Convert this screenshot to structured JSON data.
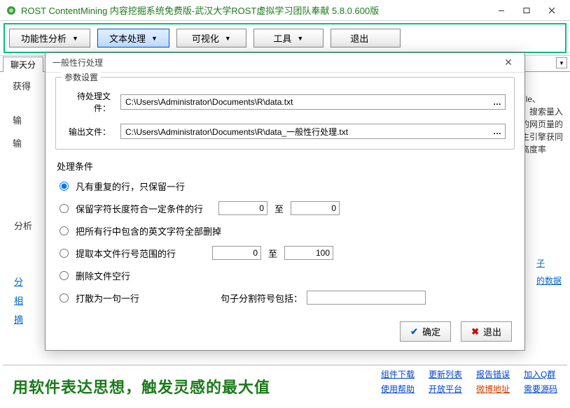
{
  "titlebar": {
    "text": "ROST ContentMining 内容挖掘系统免费版-武汉大学ROST虚拟学习团队奉献  5.8.0.600版"
  },
  "toolbar": {
    "items": [
      {
        "label": "功能性分析"
      },
      {
        "label": "文本处理"
      },
      {
        "label": "可视化"
      },
      {
        "label": "工具"
      },
      {
        "label": "退出"
      }
    ]
  },
  "tabs": {
    "first": "聊天分"
  },
  "background": {
    "heading": "获得",
    "left_items": [
      "输",
      "输"
    ],
    "analysis_label": "分析",
    "left_links": [
      "分",
      "相",
      "摘"
    ],
    "right_text_a": "gle、",
    "right_text_b": "。搜索量入的网页量的主引擎获同高度率",
    "right_links": [
      "子",
      "的数据"
    ]
  },
  "dialog": {
    "title": "一般性行处理",
    "param_legend": "参数设置",
    "input_label": "待处理文件：",
    "input_value": "C:\\Users\\Administrator\\Documents\\R\\data.txt",
    "output_label": "输出文件：",
    "output_value": "C:\\Users\\Administrator\\Documents\\R\\data_一般性行处理.txt",
    "cond_title": "处理条件",
    "opts": {
      "dedup": "凡有重复的行，只保留一行",
      "length": "保留字符长度符合一定条件的行",
      "length_from": "0",
      "length_to": "0",
      "to_label": "至",
      "strip_english": "把所有行中包含的英文字符全部删掉",
      "line_range": "提取本文件行号范围的行",
      "range_from": "0",
      "range_to": "100",
      "del_empty": "删除文件空行",
      "split_sentence": "打散为一句一行",
      "sentence_sep_label": "句子分割符号包括：",
      "sentence_sep_value": ""
    },
    "ok": "确定",
    "cancel": "退出"
  },
  "slogan": "用软件表达思想，触发灵感的最大值",
  "bottom_links": {
    "row1": [
      "组件下载",
      "更新列表",
      "报告错误",
      "加入Q群"
    ],
    "row2": [
      "使用帮助",
      "开放平台",
      "微博地址",
      "需要源码"
    ]
  }
}
